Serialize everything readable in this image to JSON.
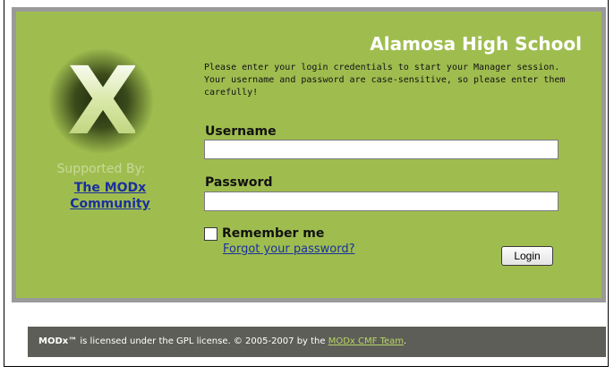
{
  "site": {
    "title": "Alamosa High School",
    "intro": "Please enter your login credentials to start your Manager session. Your username and password are case-sensitive, so please enter them carefully!"
  },
  "sidebar": {
    "supported_by": "Supported By:",
    "community_link": "The MODx Community"
  },
  "form": {
    "username_label": "Username",
    "username_value": "",
    "password_label": "Password",
    "password_value": "",
    "remember_label": "Remember me",
    "remember_checked": false,
    "forgot_link": "Forgot your password?",
    "login_button": "Login"
  },
  "footer": {
    "brand": "MODx™",
    "license_text": " is licensed under the GPL license. © 2005-2007 by the ",
    "team_link": "MODx CMF Team",
    "end": "."
  },
  "colors": {
    "panel_bg": "#9fbd4f",
    "panel_border": "#9a9a9a",
    "footer_bg": "#5e5e58",
    "link_blue": "#1a2f9e",
    "footer_link": "#b7d665"
  },
  "icons": {
    "logo": "modx-x-logo-icon"
  }
}
